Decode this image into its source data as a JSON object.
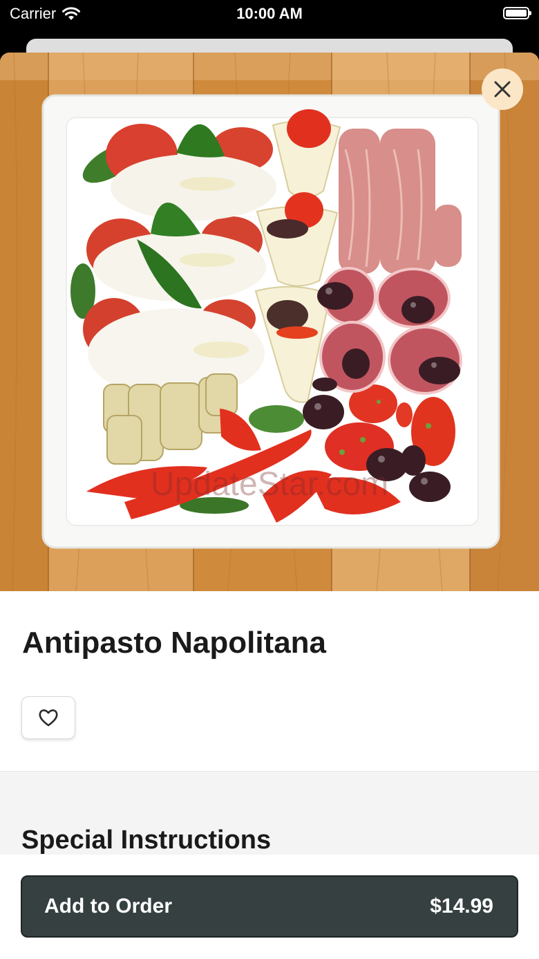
{
  "status_bar": {
    "carrier": "Carrier",
    "time": "10:00 AM"
  },
  "hero": {
    "watermark": "UpdateStar.com"
  },
  "item": {
    "title": "Antipasto Napolitana"
  },
  "special_instructions": {
    "title": "Special Instructions"
  },
  "order_button": {
    "label": "Add to Order",
    "price": "$14.99"
  },
  "icons": {
    "close": "close-icon",
    "favorite": "heart-outline-icon",
    "wifi": "wifi-icon",
    "battery": "battery-full-icon"
  },
  "colors": {
    "close_button_bg": "#fbe6c8",
    "order_button_bg": "#364041",
    "wood": "#d39245",
    "plate": "#f8f8f6"
  }
}
